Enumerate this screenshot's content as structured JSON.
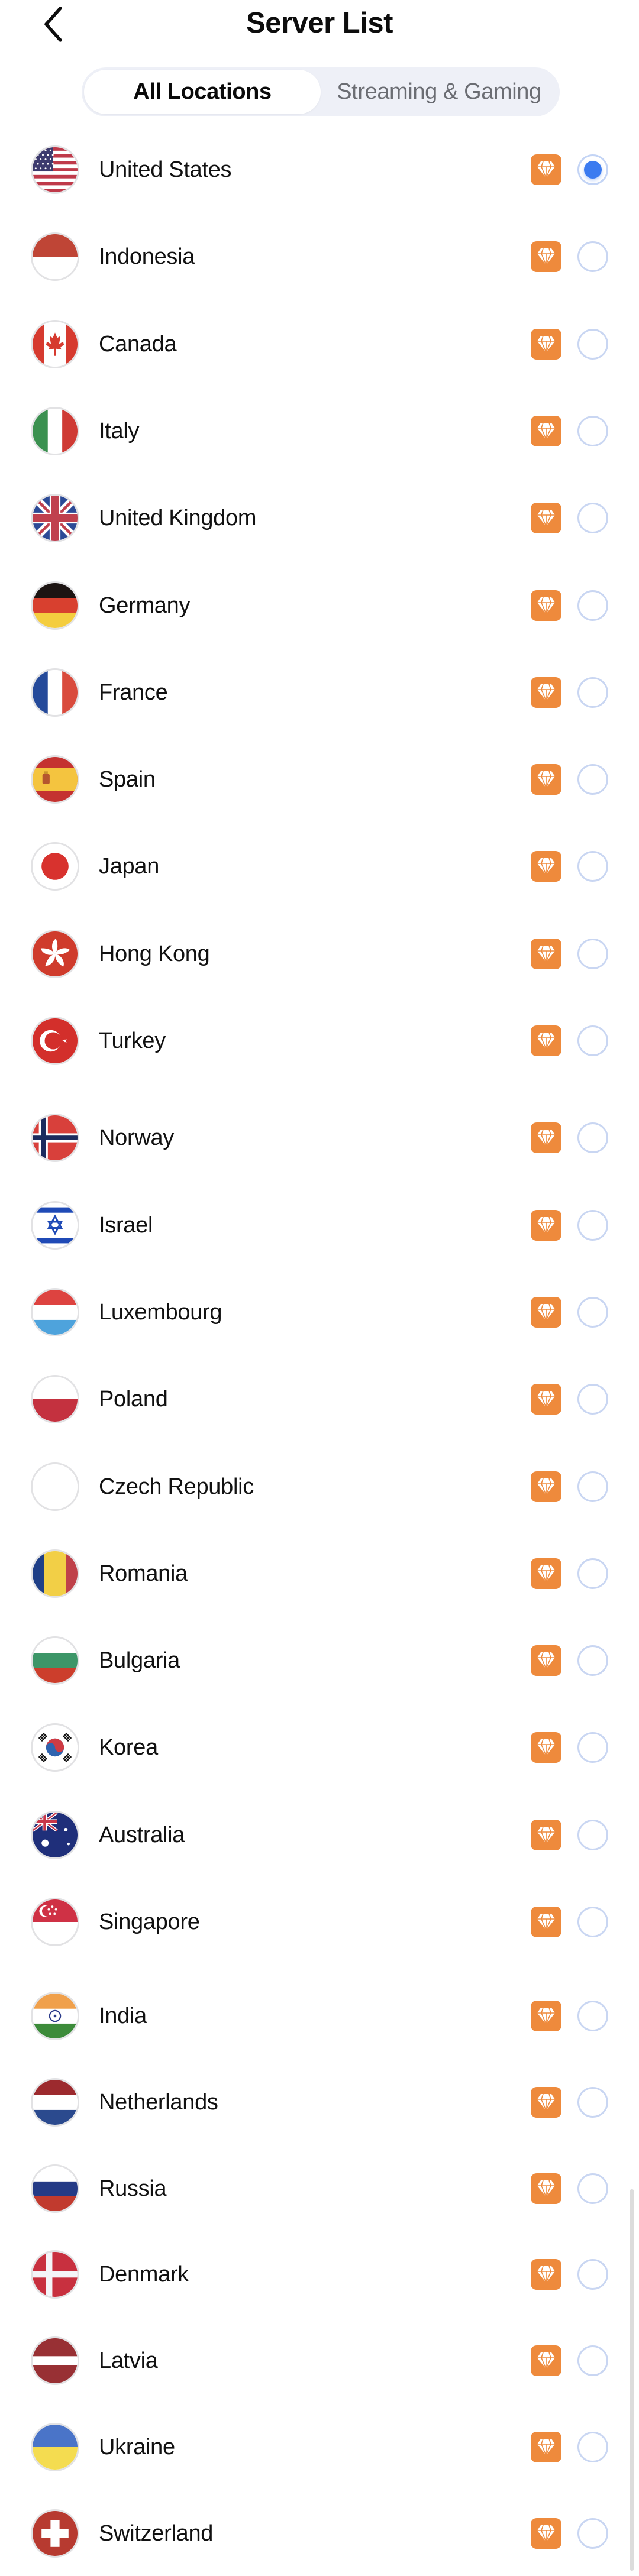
{
  "header": {
    "title": "Server List",
    "back_icon": "chevron-left-icon"
  },
  "tabs": [
    {
      "label": "All Locations",
      "active": true
    },
    {
      "label": "Streaming & Gaming",
      "active": false
    }
  ],
  "colors": {
    "premium_badge": "#ee8a3c",
    "radio_selected": "#3b7bf0",
    "radio_border": "#c9d6f2",
    "segmented_bg": "#eef0f7"
  },
  "servers": [
    {
      "name": "United States",
      "flag": "us",
      "premium": true,
      "selected": true
    },
    {
      "name": "Indonesia",
      "flag": "id",
      "premium": true,
      "selected": false
    },
    {
      "name": "Canada",
      "flag": "ca",
      "premium": true,
      "selected": false
    },
    {
      "name": "Italy",
      "flag": "it",
      "premium": true,
      "selected": false
    },
    {
      "name": "United Kingdom",
      "flag": "gb",
      "premium": true,
      "selected": false
    },
    {
      "name": "Germany",
      "flag": "de",
      "premium": true,
      "selected": false
    },
    {
      "name": "France",
      "flag": "fr",
      "premium": true,
      "selected": false
    },
    {
      "name": "Spain",
      "flag": "es",
      "premium": true,
      "selected": false
    },
    {
      "name": "Japan",
      "flag": "jp",
      "premium": true,
      "selected": false
    },
    {
      "name": "Hong Kong",
      "flag": "hk",
      "premium": true,
      "selected": false
    },
    {
      "name": "Turkey",
      "flag": "tr",
      "premium": true,
      "selected": false
    },
    {
      "name": "Norway",
      "flag": "no",
      "premium": true,
      "selected": false
    },
    {
      "name": "Israel",
      "flag": "il",
      "premium": true,
      "selected": false
    },
    {
      "name": "Luxembourg",
      "flag": "lu",
      "premium": true,
      "selected": false
    },
    {
      "name": "Poland",
      "flag": "pl",
      "premium": true,
      "selected": false
    },
    {
      "name": "Czech Republic",
      "flag": "cz-blank",
      "premium": true,
      "selected": false
    },
    {
      "name": "Romania",
      "flag": "ro",
      "premium": true,
      "selected": false
    },
    {
      "name": "Bulgaria",
      "flag": "bg",
      "premium": true,
      "selected": false
    },
    {
      "name": "Korea",
      "flag": "kr",
      "premium": true,
      "selected": false
    },
    {
      "name": "Australia",
      "flag": "au",
      "premium": true,
      "selected": false
    },
    {
      "name": "Singapore",
      "flag": "sg",
      "premium": true,
      "selected": false
    },
    {
      "name": "India",
      "flag": "in",
      "premium": true,
      "selected": false
    },
    {
      "name": "Netherlands",
      "flag": "nl",
      "premium": true,
      "selected": false
    },
    {
      "name": "Russia",
      "flag": "ru",
      "premium": true,
      "selected": false
    },
    {
      "name": "Denmark",
      "flag": "dk",
      "premium": true,
      "selected": false
    },
    {
      "name": "Latvia",
      "flag": "lv",
      "premium": true,
      "selected": false
    },
    {
      "name": "Ukraine",
      "flag": "ua",
      "premium": true,
      "selected": false
    },
    {
      "name": "Switzerland",
      "flag": "ch",
      "premium": true,
      "selected": false
    }
  ]
}
